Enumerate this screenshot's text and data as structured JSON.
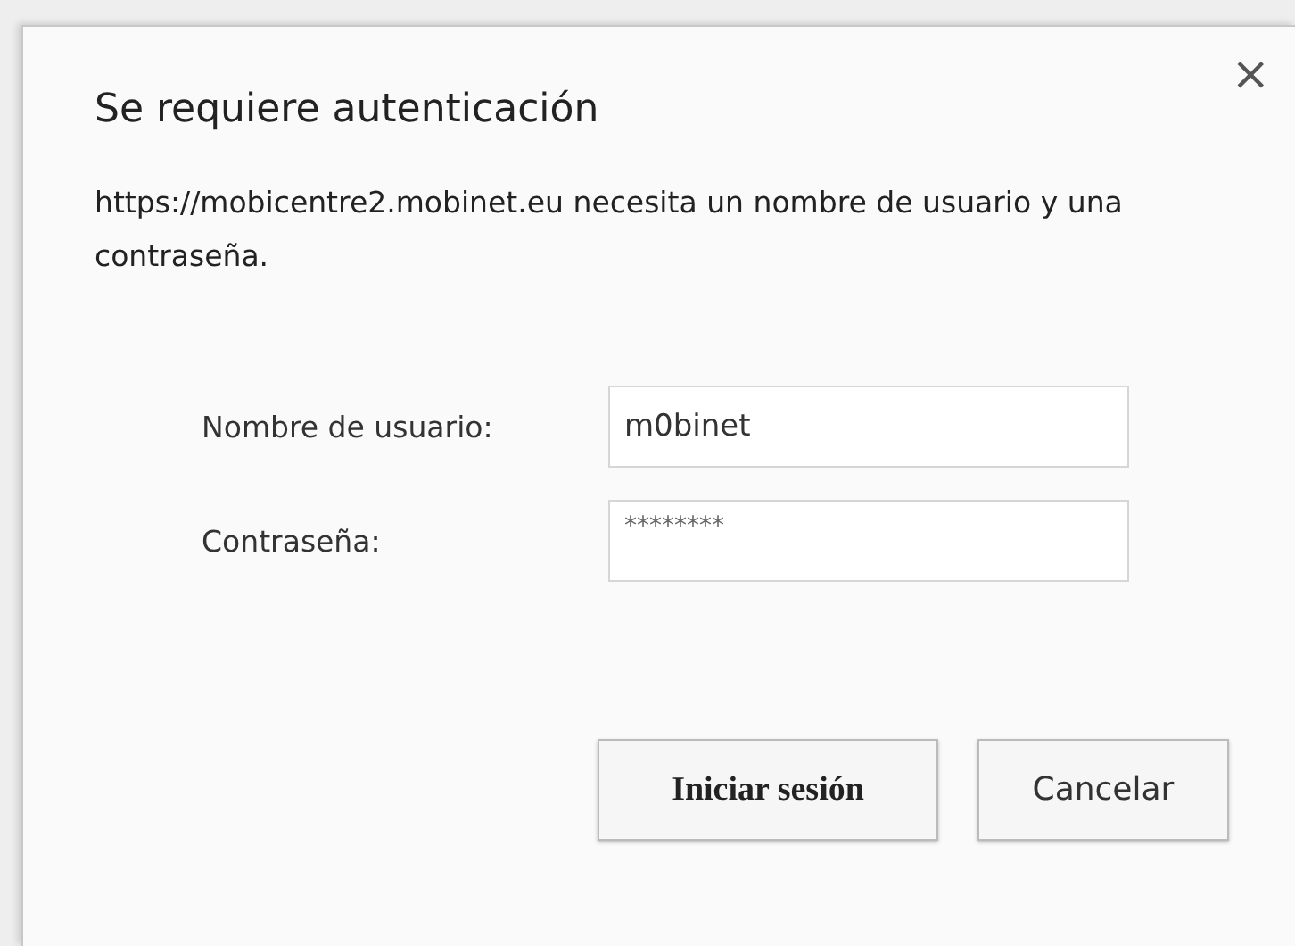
{
  "dialog": {
    "title": "Se requiere autenticación",
    "close": "×",
    "message": "https://mobicentre2.mobinet.eu necesita un nombre de usuario y una contraseña."
  },
  "fields": [
    {
      "label": "Nombre de usuario:",
      "value": "m0binet"
    },
    {
      "label": "Contraseña:",
      "value": "********"
    }
  ],
  "buttons": [
    {
      "label": "Iniciar sesión",
      "kind": "primary"
    },
    {
      "label": "Cancelar",
      "kind": "secondary"
    }
  ]
}
